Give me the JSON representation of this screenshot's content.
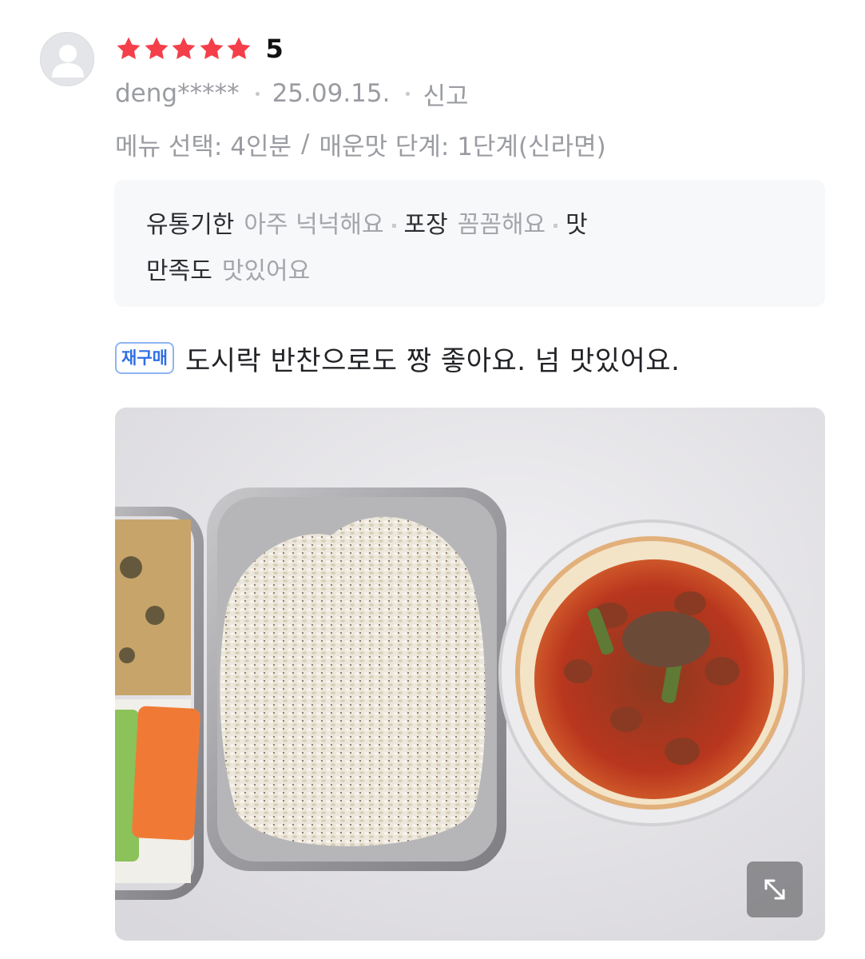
{
  "review": {
    "rating": {
      "stars_filled": 5,
      "stars_total": 5,
      "value_text": "5",
      "star_color": "#f43f4a"
    },
    "author": "deng*****",
    "date": "25.09.15.",
    "report_label": "신고",
    "options": {
      "menu": "메뉴 선택: 4인분",
      "separator": "/",
      "spice": "매운맛 단계: 1단계(신라면)"
    },
    "opinions": [
      {
        "key": "유통기한",
        "value": "아주 넉넉해요"
      },
      {
        "key": "포장",
        "value": "꼼꼼해요"
      },
      {
        "key": "맛",
        "value": ""
      }
    ],
    "opinions_line2": [
      {
        "key": "만족도",
        "value": "맛있어요"
      }
    ],
    "repurchase_badge": "재구매",
    "text": "도시락 반찬으로도 짱 좋아요. 넘 맛있어요.",
    "photo": {
      "description_icon": "photo-expand-icon"
    }
  }
}
